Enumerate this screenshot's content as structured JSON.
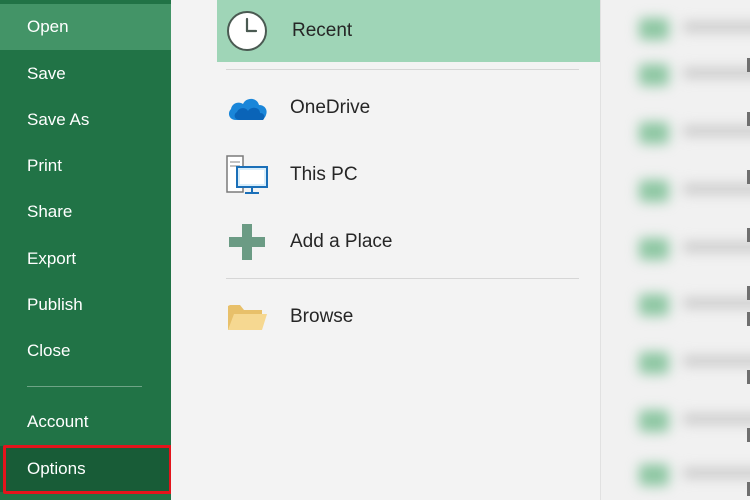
{
  "sidebar": {
    "items": [
      {
        "label": "Open"
      },
      {
        "label": "Save"
      },
      {
        "label": "Save As"
      },
      {
        "label": "Print"
      },
      {
        "label": "Share"
      },
      {
        "label": "Export"
      },
      {
        "label": "Publish"
      },
      {
        "label": "Close"
      },
      {
        "label": "Account"
      },
      {
        "label": "Options"
      }
    ],
    "selected": "Open",
    "highlighted": "Options",
    "colors": {
      "background": "#217346",
      "selected": "#439467",
      "highlight_border": "#e3141c"
    }
  },
  "locations": {
    "items": [
      {
        "label": "Recent",
        "icon": "clock-icon"
      },
      {
        "label": "OneDrive",
        "icon": "cloud-icon"
      },
      {
        "label": "This PC",
        "icon": "computer-icon"
      },
      {
        "label": "Add a Place",
        "icon": "plus-icon"
      },
      {
        "label": "Browse",
        "icon": "folder-icon"
      }
    ],
    "selected": "Recent",
    "colors": {
      "selected": "#9fd5b7"
    }
  },
  "recent_files": {
    "note_visible": "blurred"
  }
}
